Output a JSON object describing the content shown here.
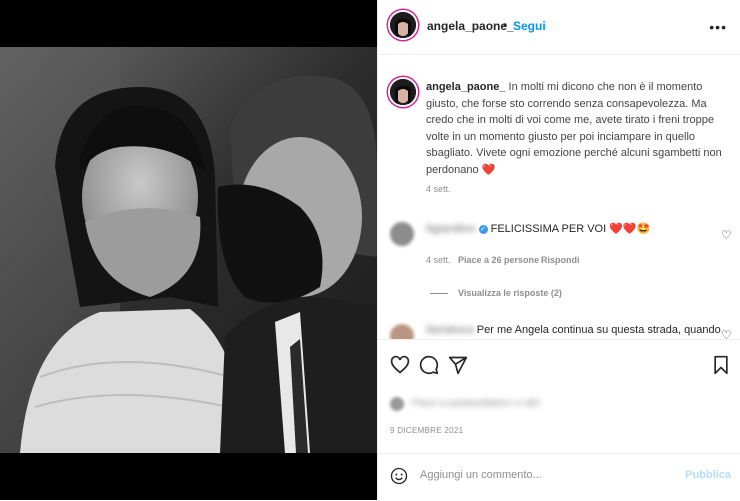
{
  "post": {
    "username": "angela_paone_",
    "follow_label": "Segui",
    "more_label": "•••",
    "caption_username": "angela_paone_",
    "caption_text": "In molti mi dicono che non è il momento giusto, che forse sto correndo senza consapevolezza. Ma credo che in molti di voi come me, avete tirato i freni troppe volte in un momento giusto per poi inciampare in quello sbagliato. Vivete ogni emozione perché alcuni sgambetti non perdonano ❤️",
    "caption_time": "4 sett.",
    "date": "9 DICEMBRE 2021"
  },
  "comments": [
    {
      "username": "ilgiardino",
      "text": "FELICISSIMA PER VOI ❤️❤️🤩",
      "time": "4 sett.",
      "likes": "Piace a 26 persone",
      "reply": "Rispondi",
      "view_replies": "Visualizza le risposte (2)"
    },
    {
      "username": "ilarialuca",
      "text": "Per me Angela continua su questa strada, quando"
    }
  ],
  "likes_blurred": "Piace a paolasollabern e altri",
  "add_comment": {
    "placeholder": "Aggiungi un commento...",
    "publish_label": "Pubblica"
  },
  "colors": {
    "accent": "#0095f6",
    "publish_disabled": "#b2dffc",
    "heart": "#ed4956"
  }
}
